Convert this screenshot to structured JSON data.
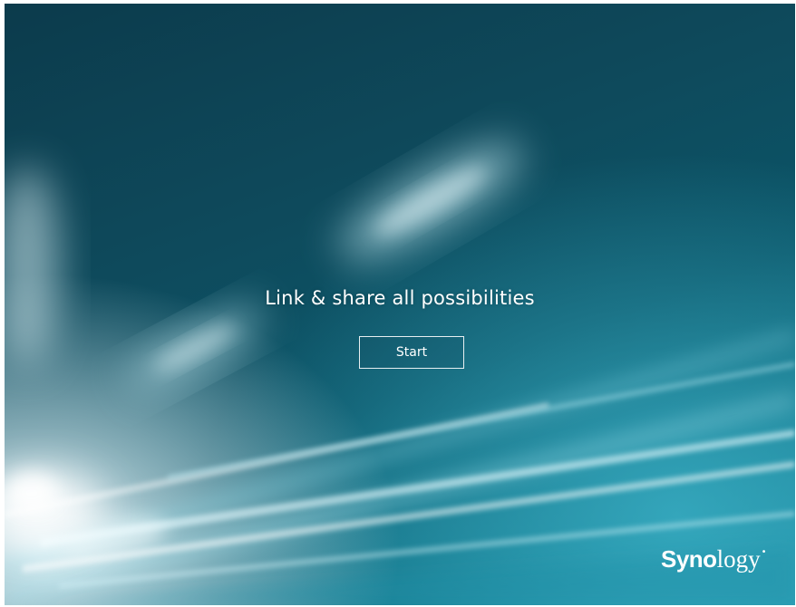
{
  "window": {
    "headline": "Link & share all possibilities",
    "start_label": "Start"
  },
  "logo": {
    "name_bold": "Syno",
    "name_thin": "logy",
    "mark": "•"
  },
  "colors": {
    "background_dark": "#0c3b4c",
    "background_light": "#1c8aa0",
    "text": "#ffffff"
  }
}
